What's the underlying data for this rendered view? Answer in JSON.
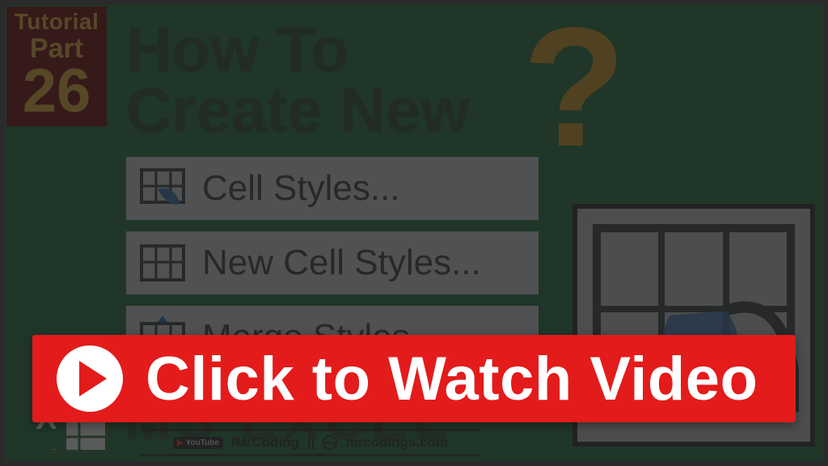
{
  "badge": {
    "line1": "Tutorial",
    "line2": "Part",
    "number": "26"
  },
  "heading": {
    "line1": "How To",
    "line2": "Create New"
  },
  "qmark": "?",
  "menu": {
    "items": [
      {
        "label": "Cell Styles...",
        "icon": "grid-brush-icon"
      },
      {
        "label": "New Cell Styles...",
        "icon": "grid-icon"
      },
      {
        "label": "Merge Styles...",
        "icon": "grid-merge-icon"
      }
    ]
  },
  "excel": {
    "title": "MS EXCEL"
  },
  "footer": {
    "youtube_label": "YouTube",
    "yt_handle": "/MrCoding",
    "separator": "||",
    "site": "mrcodings.com"
  },
  "cta": {
    "text": "Click to Watch Video"
  }
}
